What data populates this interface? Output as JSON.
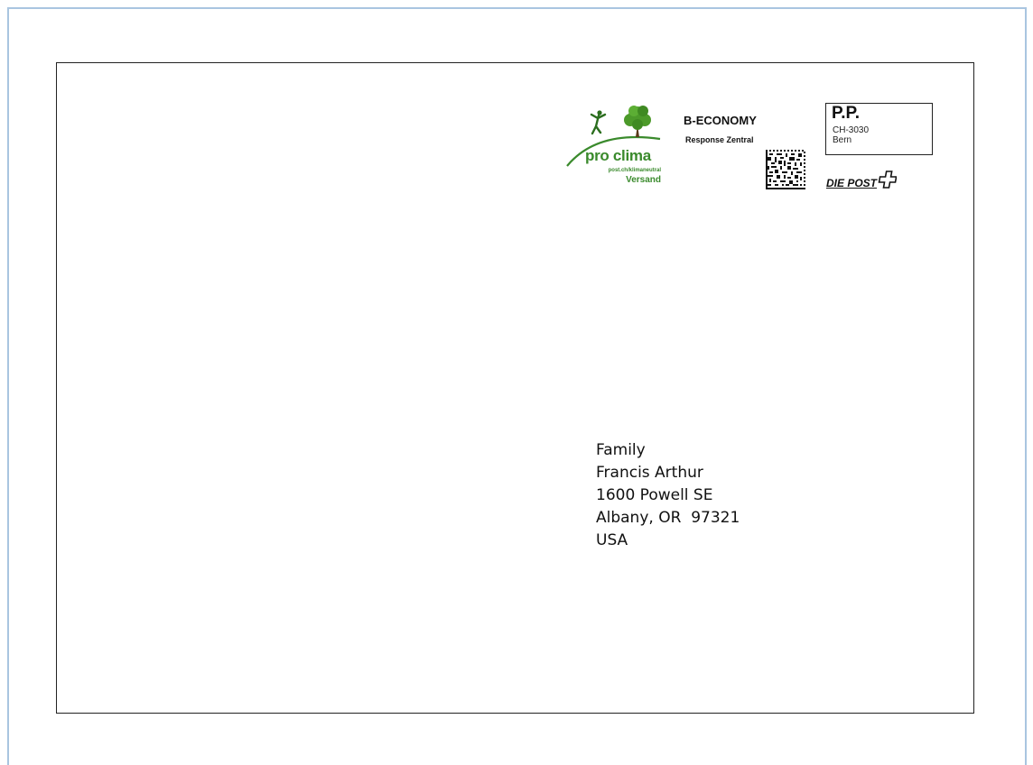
{
  "envelope": {
    "logo": {
      "name": "pro clima",
      "url": "post.ch/klimaneutral",
      "versand": "Versand",
      "color": "#3a8a2c"
    },
    "franking": {
      "service": "B-ECONOMY",
      "service_sub": "Response Zentral",
      "pp_title": "P.P.",
      "pp_zip": "CH-3030",
      "pp_city": "Bern",
      "post_brand": "DIE POST"
    },
    "recipient": {
      "lines": [
        "Family",
        "Francis Arthur",
        "1600 Powell SE",
        "Albany, OR  97321",
        "USA"
      ]
    }
  }
}
